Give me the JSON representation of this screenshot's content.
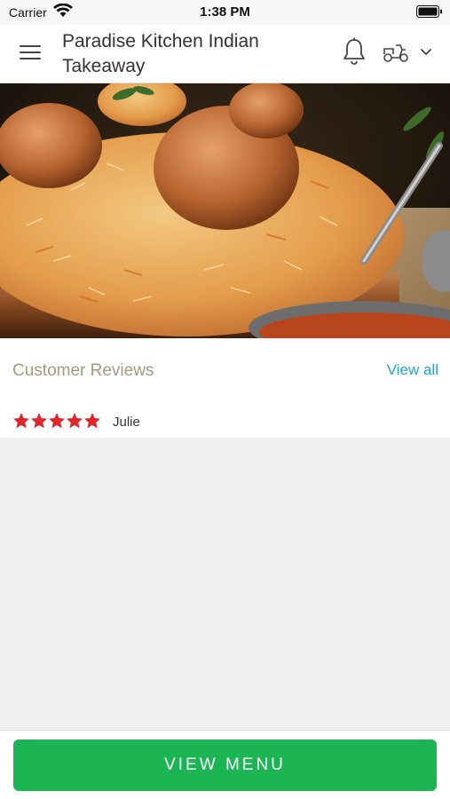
{
  "status_bar": {
    "carrier": "Carrier",
    "time": "1:38 PM"
  },
  "header": {
    "title": "Paradise Kitchen Indian Takeaway",
    "icons": [
      "menu-icon",
      "bell-icon",
      "delivery-scooter-icon",
      "chevron-down-icon"
    ]
  },
  "hero": {
    "description_icon": "biryani-photo"
  },
  "reviews": {
    "title": "Customer Reviews",
    "view_all_label": "View all",
    "items": [
      {
        "rating": 5,
        "max_rating": 5,
        "name": "Julie"
      }
    ]
  },
  "footer": {
    "button_label": "VIEW MENU"
  },
  "colors": {
    "accent_green": "#1bb553",
    "link_blue": "#2b9ed3",
    "star_red": "#e0252b",
    "section_title": "#a59a7f"
  }
}
